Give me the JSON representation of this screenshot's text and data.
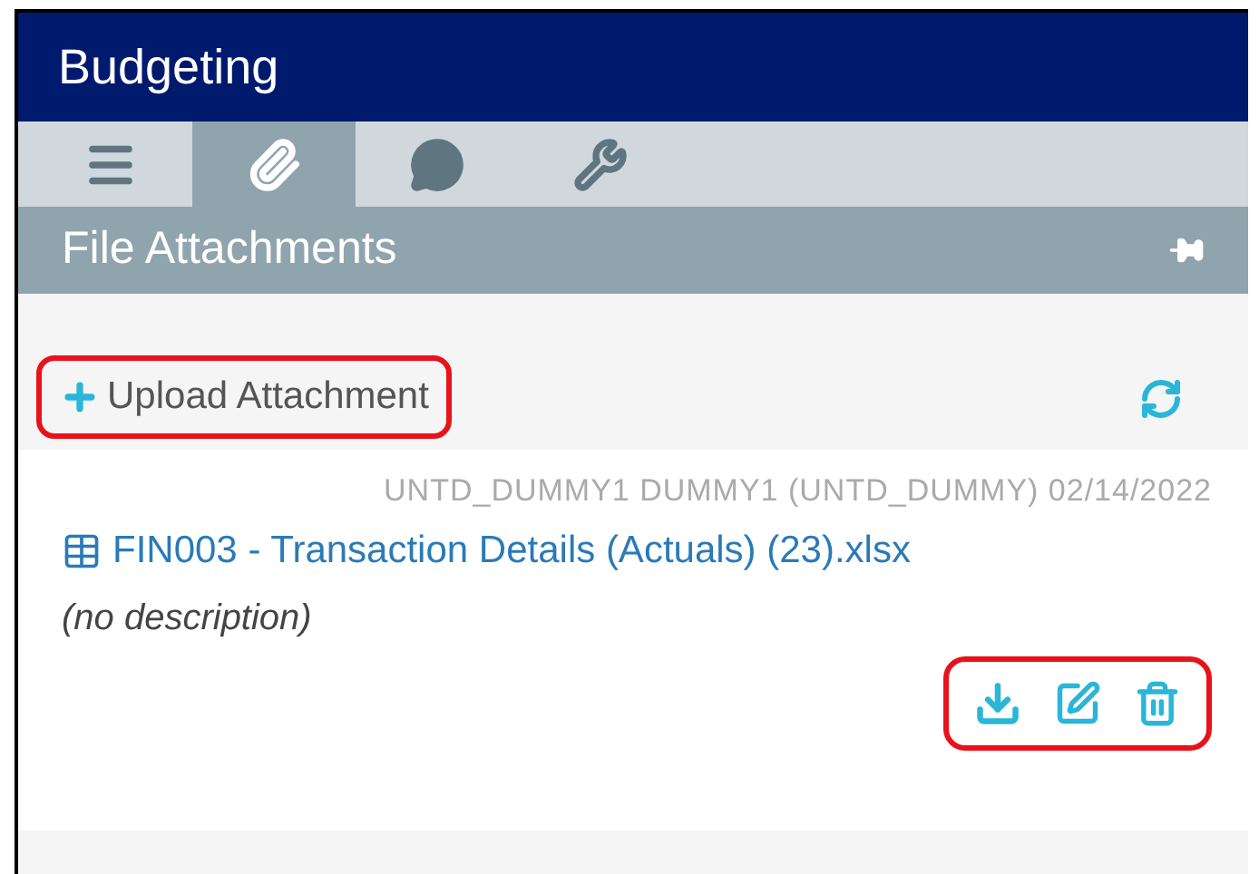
{
  "window": {
    "title": "Budgeting"
  },
  "tabs": [
    {
      "kind": "menu",
      "selected": false
    },
    {
      "kind": "attachments",
      "selected": true
    },
    {
      "kind": "comments",
      "selected": false
    },
    {
      "kind": "tools",
      "selected": false
    }
  ],
  "panel": {
    "title": "File Attachments"
  },
  "upload_button": {
    "label": "Upload Attachment",
    "highlighted": true
  },
  "attachments": [
    {
      "meta": "UNTD_DUMMY1 DUMMY1 (UNTD_DUMMY) 02/14/2022",
      "file": "FIN003 - Transaction Details (Actuals) (23).xlsx",
      "description": "(no description)",
      "actions_highlighted": true
    }
  ]
}
